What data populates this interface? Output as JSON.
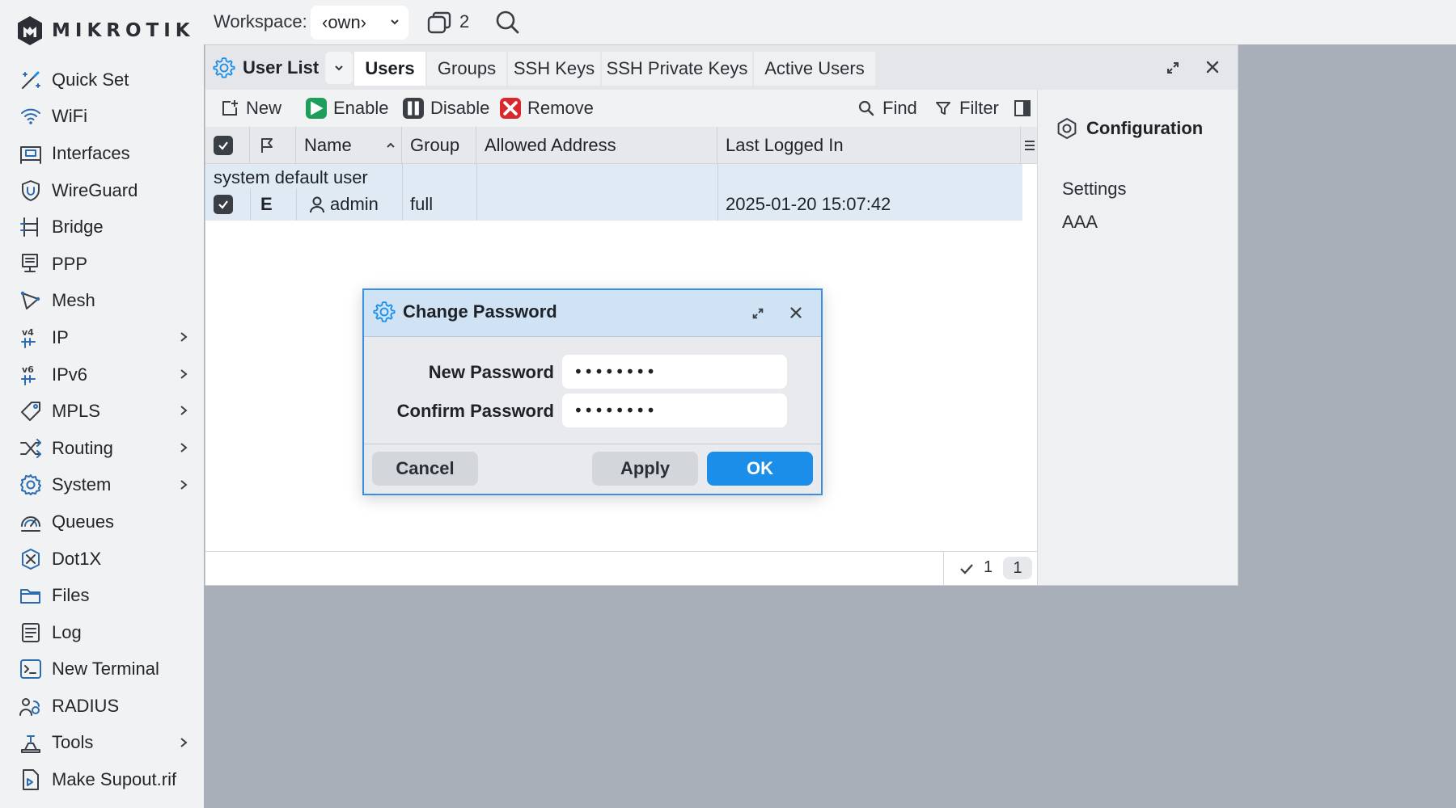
{
  "brand": {
    "name": "MIKROTIK"
  },
  "colors": {
    "accent": "#1a8ee8",
    "enable": "#1e9e5a",
    "remove": "#d9272e",
    "disable": "#3a3f46"
  },
  "sidebar": {
    "items": [
      {
        "label": "Quick Set",
        "icon": "quick-set-icon",
        "submenu": false
      },
      {
        "label": "WiFi",
        "icon": "wifi-icon",
        "submenu": false
      },
      {
        "label": "Interfaces",
        "icon": "interfaces-icon",
        "submenu": false
      },
      {
        "label": "WireGuard",
        "icon": "wireguard-icon",
        "submenu": false
      },
      {
        "label": "Bridge",
        "icon": "bridge-icon",
        "submenu": false
      },
      {
        "label": "PPP",
        "icon": "ppp-icon",
        "submenu": false
      },
      {
        "label": "Mesh",
        "icon": "mesh-icon",
        "submenu": false
      },
      {
        "label": "IP",
        "icon": "ip-icon",
        "submenu": true
      },
      {
        "label": "IPv6",
        "icon": "ipv6-icon",
        "submenu": true
      },
      {
        "label": "MPLS",
        "icon": "mpls-icon",
        "submenu": true
      },
      {
        "label": "Routing",
        "icon": "routing-icon",
        "submenu": true
      },
      {
        "label": "System",
        "icon": "system-icon",
        "submenu": true
      },
      {
        "label": "Queues",
        "icon": "queues-icon",
        "submenu": false
      },
      {
        "label": "Dot1X",
        "icon": "dot1x-icon",
        "submenu": false
      },
      {
        "label": "Files",
        "icon": "files-icon",
        "submenu": false
      },
      {
        "label": "Log",
        "icon": "log-icon",
        "submenu": false
      },
      {
        "label": "New Terminal",
        "icon": "terminal-icon",
        "submenu": false
      },
      {
        "label": "RADIUS",
        "icon": "radius-icon",
        "submenu": false
      },
      {
        "label": "Tools",
        "icon": "tools-icon",
        "submenu": true
      },
      {
        "label": "Make Supout.rif",
        "icon": "supout-icon",
        "submenu": false
      }
    ]
  },
  "topbar": {
    "workspace_label": "Workspace:",
    "workspace_value": "‹own›",
    "window_count": "2"
  },
  "window": {
    "title": "User List",
    "tabs": [
      {
        "label": "Users",
        "active": true
      },
      {
        "label": "Groups",
        "active": false
      },
      {
        "label": "SSH Keys",
        "active": false
      },
      {
        "label": "SSH Private Keys",
        "active": false
      },
      {
        "label": "Active Users",
        "active": false
      }
    ],
    "toolbar": {
      "new": "New",
      "enable": "Enable",
      "disable": "Disable",
      "remove": "Remove",
      "find": "Find",
      "filter": "Filter"
    },
    "columns": {
      "name": "Name",
      "group": "Group",
      "allowed_address": "Allowed Address",
      "last_logged_in": "Last Logged In"
    },
    "rows": [
      {
        "comment": "system default user",
        "flag": "E",
        "name": "admin",
        "group": "full",
        "allowed_address": "",
        "last_logged_in": "2025-01-20 15:07:42"
      }
    ],
    "status": {
      "selected": "1",
      "total": "1"
    },
    "side_panel": {
      "title": "Configuration",
      "links": [
        "Settings",
        "AAA"
      ]
    }
  },
  "dialog": {
    "title": "Change Password",
    "fields": [
      {
        "label": "New Password",
        "value": "••••••••"
      },
      {
        "label": "Confirm Password",
        "value": "••••••••"
      }
    ],
    "buttons": {
      "cancel": "Cancel",
      "apply": "Apply",
      "ok": "OK"
    }
  }
}
